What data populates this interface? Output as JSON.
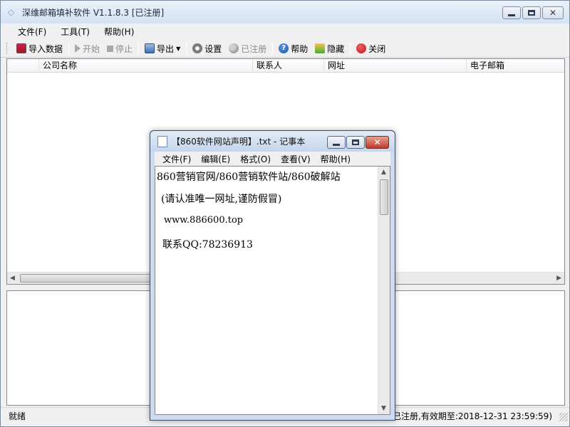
{
  "main_window": {
    "title": "深维邮箱填补软件 V1.1.8.3 [已注册]",
    "menu": [
      "文件(F)",
      "工具(T)",
      "帮助(H)"
    ],
    "toolbar": {
      "import": "导入数据",
      "start": "开始",
      "stop": "停止",
      "export": "导出",
      "settings": "设置",
      "registered": "已注册",
      "help": "帮助",
      "hide": "隐藏",
      "close": "关闭"
    },
    "table_columns": [
      "公司名称",
      "联系人",
      "网址",
      "电子邮箱"
    ],
    "status_left": "就绪",
    "status_right": "(已注册,有效期至:2018-12-31 23:59:59)"
  },
  "notepad": {
    "title": "【860软件网站声明】.txt - 记事本",
    "menu": [
      "文件(F)",
      "编辑(E)",
      "格式(O)",
      "查看(V)",
      "帮助(H)"
    ],
    "lines": [
      "860营销官网/860营销软件站/860破解站",
      "(请认准唯一网址,谨防假冒)",
      " www.886600.top",
      "联系QQ:78236913"
    ]
  }
}
